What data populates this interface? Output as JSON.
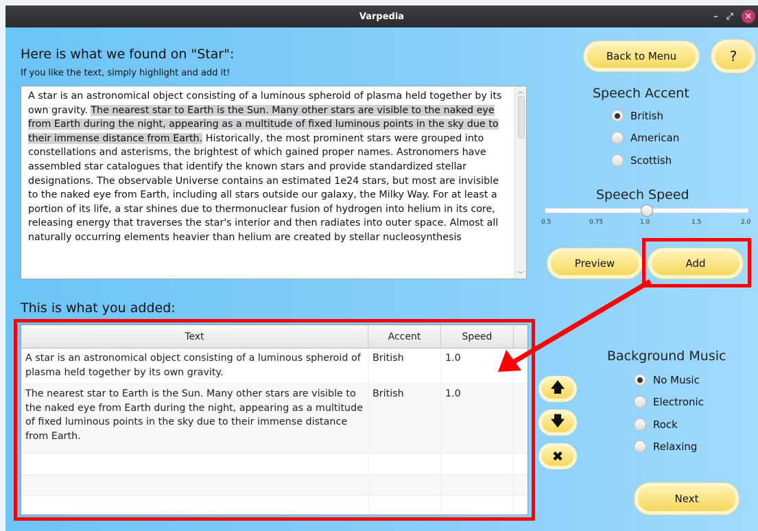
{
  "window": {
    "title": "Varpedia"
  },
  "search": {
    "heading": "Here is what we found on \"Star\":",
    "instruction": "If you like the text, simply highlight and add it!",
    "text_pre": "A star is an astronomical object consisting of a luminous spheroid of plasma held together by its own gravity. ",
    "text_highlighted": "The nearest star to Earth is the Sun. Many other stars are visible to the naked eye from Earth during the night, appearing as a multitude of fixed luminous points in the sky due to their immense distance from Earth.",
    "text_post": " Historically, the most prominent stars were grouped into constellations and asterisms, the brightest of which gained proper names. Astronomers have assembled star catalogues that identify the known stars and provide standardized stellar designations. The observable Universe contains an estimated 1e24 stars, but most are invisible to the naked eye from Earth, including all stars outside our galaxy, the Milky Way. For at least a portion of its life, a star shines due to thermonuclear fusion of hydrogen into helium in its core, releasing energy that traverses the star's interior and then radiates into outer space. Almost all naturally occurring elements heavier than helium are created by stellar nucleosynthesis"
  },
  "buttons": {
    "back": "Back to Menu",
    "help": "?",
    "preview": "Preview",
    "add": "Add",
    "next": "Next"
  },
  "accent": {
    "title": "Speech Accent",
    "options": [
      "British",
      "American",
      "Scottish"
    ],
    "selected": "British"
  },
  "speed": {
    "title": "Speech Speed",
    "ticks": [
      "0.5",
      "0.75",
      "1.0",
      "1.5",
      "2.0"
    ],
    "value": 1.0
  },
  "added": {
    "heading": "This is what you added:",
    "columns": [
      "Text",
      "Accent",
      "Speed"
    ],
    "rows": [
      {
        "text": "A star is an astronomical object consisting of a luminous spheroid of plasma held together by its own gravity.",
        "accent": "British",
        "speed": "1.0"
      },
      {
        "text": "The nearest star to Earth is the Sun. Many other stars are visible to the naked eye from Earth during the night, appearing as a multitude of fixed luminous points in the sky due to their immense distance from Earth.",
        "accent": "British",
        "speed": "1.0"
      }
    ]
  },
  "music": {
    "title": "Background Music",
    "options": [
      "No Music",
      "Electronic",
      "Rock",
      "Relaxing"
    ],
    "selected": "No Music"
  },
  "icons": {
    "up": "arrow-up-icon",
    "down": "arrow-down-icon",
    "delete": "close-icon"
  },
  "colors": {
    "annotation": "#ff0000",
    "button": "#f6d85e",
    "background": "#6cc3f7"
  }
}
